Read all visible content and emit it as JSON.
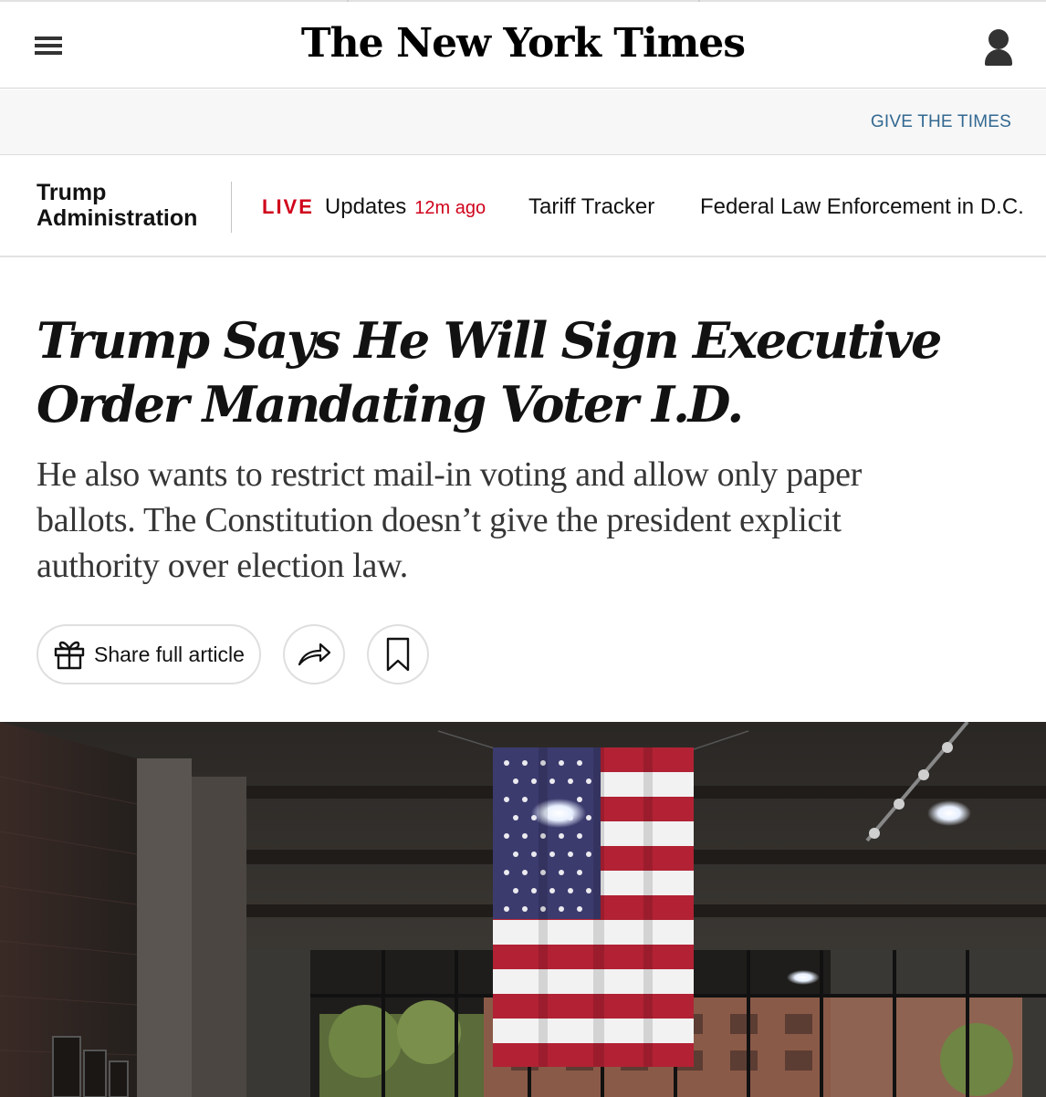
{
  "masthead": {
    "logo": "The New York Times",
    "menu_icon": "hamburger-menu-icon",
    "account_icon": "user-account-icon"
  },
  "give_bar": {
    "link": "GIVE THE TIMES"
  },
  "section_nav": {
    "section_title": "Trump Administration",
    "live_badge": "LIVE",
    "live_label": "Updates",
    "live_time": "12m ago",
    "items": [
      {
        "label": "Tariff Tracker"
      },
      {
        "label": "Federal Law Enforcement in D.C."
      }
    ]
  },
  "article": {
    "headline": "Trump Says He Will Sign Executive Order Mandating Voter I.D.",
    "summary": "He also wants to restrict mail-in voting and allow only paper ballots. The Constitution doesn’t give the president explicit authority over election law.",
    "share_label": "Share full article",
    "share_icon": "gift-icon",
    "forward_icon": "share-arrow-icon",
    "bookmark_icon": "bookmark-icon"
  },
  "colors": {
    "live_red": "#d0021b",
    "link_blue": "#326891",
    "text": "#121212",
    "summary_gray": "#363636"
  }
}
